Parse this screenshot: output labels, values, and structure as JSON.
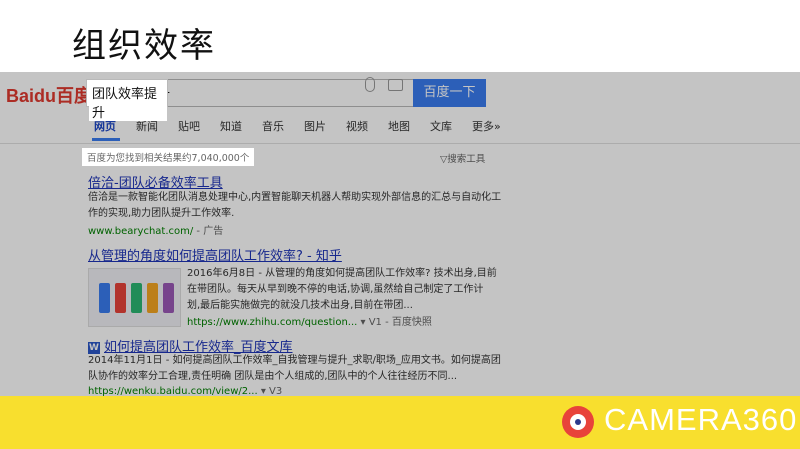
{
  "slide": {
    "title": "组织效率"
  },
  "baidu": {
    "logo_text": "Baidu百度",
    "search_query": "团队效率提升",
    "search_button": "百度一下",
    "icons": {
      "voice": "microphone-icon",
      "image_search": "camera-icon",
      "logo_paw": "paw-icon"
    },
    "tabs": [
      "网页",
      "新闻",
      "贴吧",
      "知道",
      "音乐",
      "图片",
      "视频",
      "地图",
      "文库",
      "更多»"
    ],
    "result_count": "百度为您找到相关结果约7,040,000个",
    "search_tools": "▽搜索工具",
    "results": [
      {
        "title": "倍洽-团队必备效率工具",
        "desc": [
          "倍洽是一款智能化团队消息处理中心,内置智能聊天机器人帮助实现外部信息的汇总与自动化工",
          "作的实现,助力团队提升工作效率."
        ],
        "url": "www.bearychat.com/",
        "url_extra": " - 广告"
      },
      {
        "title": "从管理的角度如何提高团队工作效率? - 知乎",
        "desc": [
          "2016年6月8日 - 从管理的角度如何提高团队工作效率? 技术出身,目前",
          "在带团队。每天从早到晚不停的电话,协调,虽然给自己制定了工作计",
          "划,最后能实施做完的就没几技术出身,目前在带团..."
        ],
        "url": "https://www.zhihu.com/question...",
        "url_extra": " ▾ V1 - 百度快照"
      },
      {
        "title": "如何提高团队工作效率_百度文库",
        "desc": [
          "2014年11月1日 - 如何提高团队工作效率_自我管理与提升_求职/职场_应用文书。如何提高团",
          "队协作的效率分工合理,责任明确 团队是由个人组成的,团队中的个人往往经历不同..."
        ],
        "url": "https://wenku.baidu.com/view/2...",
        "url_extra": " ▾ V3"
      }
    ]
  },
  "footer": {
    "brand": "CAMERA360",
    "brand_icon": "camera360-logo-icon"
  },
  "colors": {
    "banner": "#f8df2e",
    "link": "#1e34b8",
    "url": "#008000",
    "button": "#3a7cf0",
    "highlight": "#e03a2f"
  }
}
